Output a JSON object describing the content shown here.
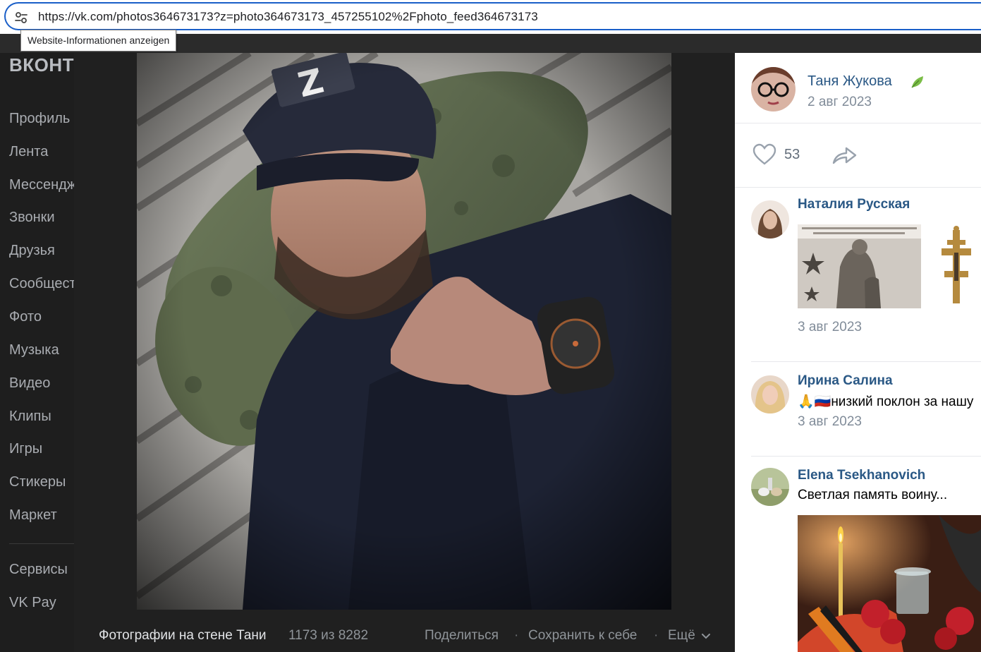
{
  "browser": {
    "url": "https://vk.com/photos364673173?z=photo364673173_457255102%2Fphoto_feed364673173",
    "site_info_tooltip": "Website-Informationen anzeigen"
  },
  "sidebar": {
    "logo": "ВКОНТ",
    "items": [
      {
        "label": "Профиль"
      },
      {
        "label": "Лента"
      },
      {
        "label": "Мессендж"
      },
      {
        "label": "Звонки"
      },
      {
        "label": "Друзья"
      },
      {
        "label": "Сообщест"
      },
      {
        "label": "Фото"
      },
      {
        "label": "Музыка"
      },
      {
        "label": "Видео"
      },
      {
        "label": "Клипы"
      },
      {
        "label": "Игры"
      },
      {
        "label": "Стикеры"
      },
      {
        "label": "Маркет"
      }
    ],
    "extra_items": [
      {
        "label": "Сервисы"
      },
      {
        "label": "VK Pay"
      }
    ]
  },
  "viewer": {
    "caption": "Фотографии на стене Тани",
    "counter": "1173 из 8282",
    "actions": {
      "share": "Поделиться",
      "save": "Сохранить к себе",
      "more": "Ещё"
    },
    "separator": "·"
  },
  "post": {
    "author_name": "Таня Жукова",
    "date": "2 авг 2023",
    "likes": "53"
  },
  "comments": [
    {
      "name": "Наталия Русская",
      "text": "",
      "date": "3 авг 2023"
    },
    {
      "name": "Ирина Салина",
      "text": "🙏🇷🇺низкий поклон за нашу",
      "date": "3 авг 2023"
    },
    {
      "name": "Elena Tsekhanovich",
      "text": "Светлая память воину...",
      "date": ""
    }
  ],
  "colors": {
    "link": "#2a5885",
    "muted": "#818c99",
    "url_focus": "#1a5fc8"
  }
}
